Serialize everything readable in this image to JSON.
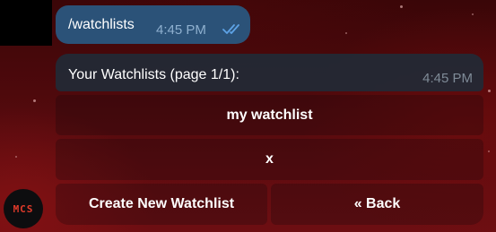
{
  "outgoing_message": {
    "text": "/watchlists",
    "time": "4:45 PM",
    "status_icon": "double-check-icon"
  },
  "incoming_message": {
    "text": "Your Watchlists (page 1/1):",
    "time": "4:45 PM"
  },
  "inline_keyboard": {
    "watchlist_button": "my watchlist",
    "x_button": "x",
    "create_button": "Create New Watchlist",
    "back_button": "« Back"
  },
  "bot_avatar": {
    "text": "MCS",
    "color": "#e03a2a"
  },
  "colors": {
    "outgoing_bubble": "#2b5278",
    "incoming_bubble": "#222a36",
    "accent_blue": "#5ea3e6"
  }
}
